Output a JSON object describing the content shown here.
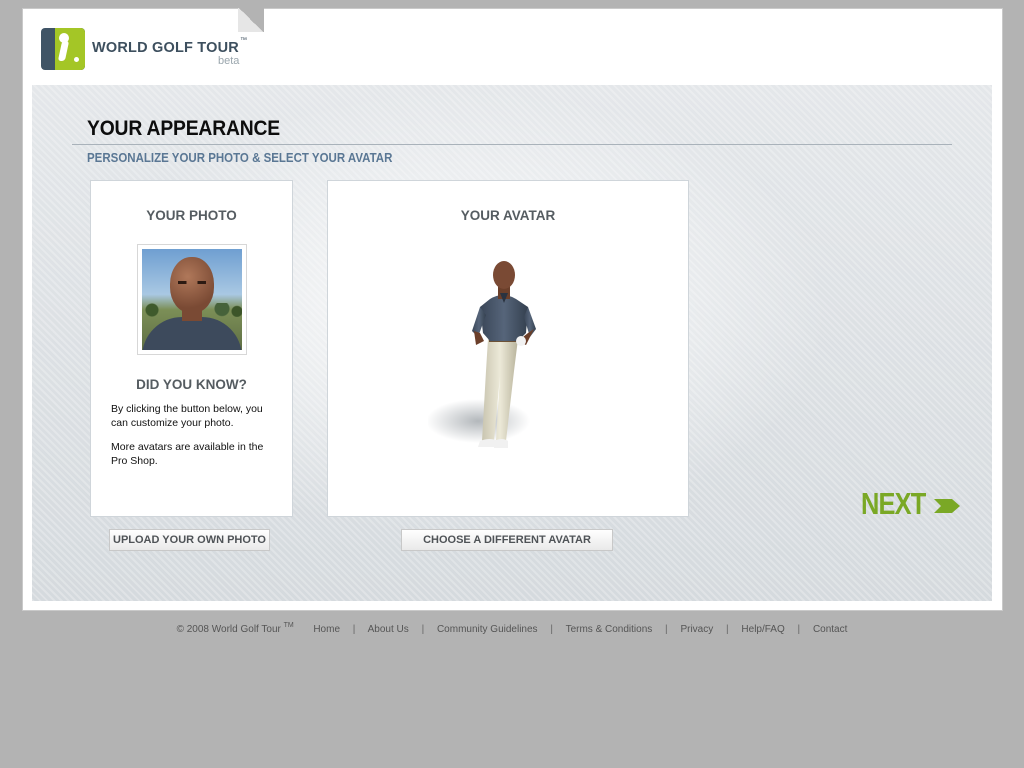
{
  "brand": {
    "name": "WORLD GOLF TOUR",
    "trademark": "™",
    "edition": "beta",
    "colors": {
      "navy": "#3f5466",
      "green": "#a4c626",
      "accent": "#7aa825"
    }
  },
  "page": {
    "title": "YOUR APPEARANCE",
    "subtitle": "PERSONALIZE YOUR PHOTO & SELECT YOUR AVATAR"
  },
  "photo_card": {
    "heading": "YOUR PHOTO",
    "did_you_know_heading": "DID YOU KNOW?",
    "tip_1": "By clicking the button below, you can customize your photo.",
    "tip_2": "More avatars are available in the Pro Shop."
  },
  "avatar_card": {
    "heading": "YOUR AVATAR"
  },
  "buttons": {
    "upload": "UPLOAD YOUR OWN PHOTO",
    "choose_avatar": "CHOOSE A DIFFERENT AVATAR",
    "next": "NEXT"
  },
  "footer": {
    "copyright": "© 2008 World Golf Tour",
    "tm": "TM",
    "separator": "|",
    "links": [
      "Home",
      "About Us",
      "Community Guidelines",
      "Terms & Conditions",
      "Privacy",
      "Help/FAQ",
      "Contact"
    ]
  }
}
